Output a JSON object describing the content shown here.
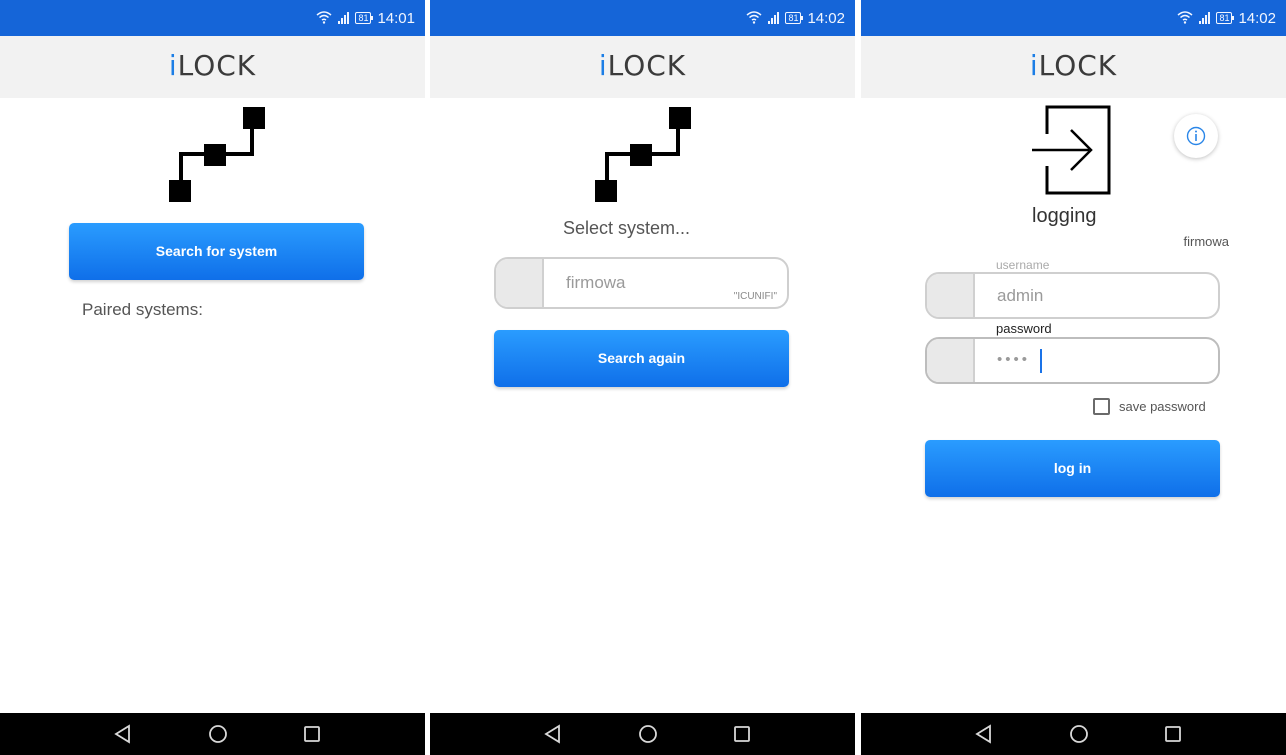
{
  "screens": [
    {
      "status": {
        "time": "14:01",
        "battery": "81"
      },
      "app": {
        "brand_i": "i",
        "brand_rest": "LOCK"
      },
      "search_button": "Search for system",
      "paired_label": "Paired systems:"
    },
    {
      "status": {
        "time": "14:02",
        "battery": "81"
      },
      "app": {
        "brand_i": "i",
        "brand_rest": "LOCK"
      },
      "select_label": "Select system...",
      "system_field": {
        "value": "firmowa",
        "note": "\"ICUNIFI\""
      },
      "search_again_button": "Search again"
    },
    {
      "status": {
        "time": "14:02",
        "battery": "81"
      },
      "app": {
        "brand_i": "i",
        "brand_rest": "LOCK"
      },
      "title": "logging",
      "system_name": "firmowa",
      "username_label": "username",
      "username_value": "admin",
      "password_label": "password",
      "password_value": "••••",
      "save_password_label": "save password",
      "save_password_checked": false,
      "login_button": "log in"
    }
  ],
  "icons": {
    "wifi": "wifi-icon",
    "signal": "signal-icon",
    "battery": "battery-icon",
    "circuit": "circuit-logo-icon",
    "login": "enter-door-icon",
    "info": "info-icon",
    "back": "back-triangle-icon",
    "home": "home-circle-icon",
    "recent": "recent-square-icon"
  },
  "colors": {
    "status_bar": "#1565d8",
    "app_bar": "#f2f2f2",
    "brand_accent": "#1c7ee6",
    "button_top": "#2a9cff",
    "button_bottom": "#0f6fe9",
    "nav_bar": "#000000"
  }
}
